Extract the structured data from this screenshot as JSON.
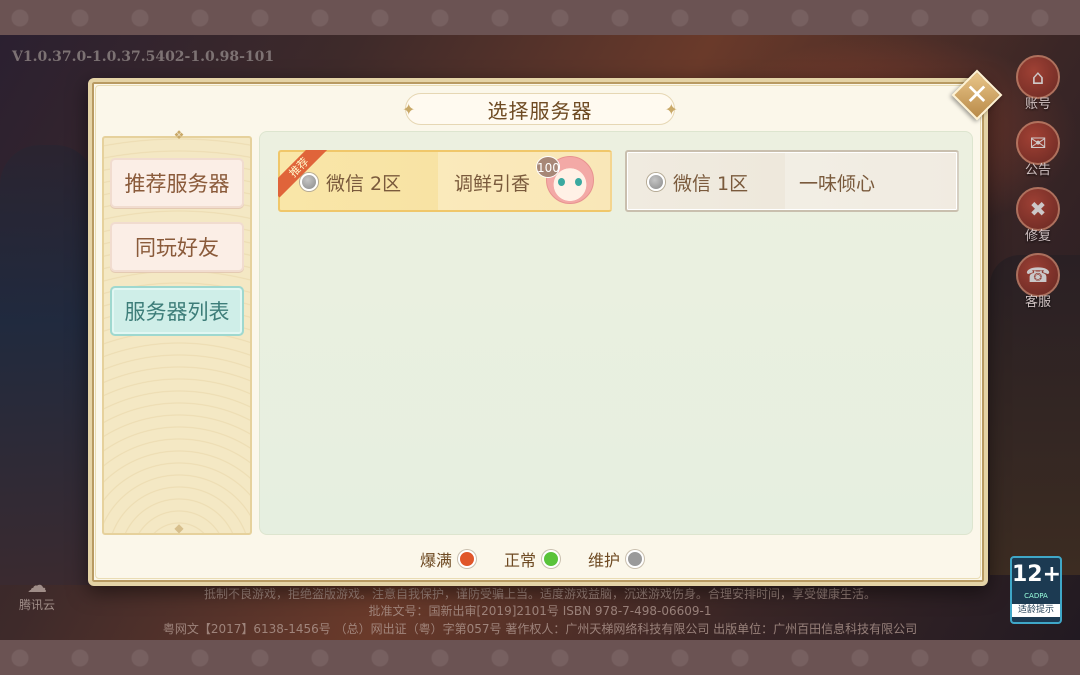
{
  "version": "V1.0.37.0-1.0.37.5402-1.0.98-101",
  "dialog": {
    "title": "选择服务器",
    "close_label": "✕"
  },
  "sidebar": {
    "tabs": [
      {
        "label": "推荐服务器",
        "active": false
      },
      {
        "label": "同玩好友",
        "active": false
      },
      {
        "label": "服务器列表",
        "active": true
      }
    ]
  },
  "servers": [
    {
      "name": "微信  2区",
      "role": "调鲜引香",
      "badge": "推荐",
      "level": "100",
      "status": "维护"
    },
    {
      "name": "微信  1区",
      "role": "一味倾心",
      "status": "维护"
    }
  ],
  "legend": [
    {
      "label": "爆满",
      "color": "#e0562a"
    },
    {
      "label": "正常",
      "color": "#59c33a"
    },
    {
      "label": "维护",
      "color": "#9a9a9a"
    }
  ],
  "right_menu": [
    {
      "label": "账号",
      "icon": "account-icon",
      "glyph": "⌂"
    },
    {
      "label": "公告",
      "icon": "announcement-icon",
      "glyph": "✉"
    },
    {
      "label": "修复",
      "icon": "repair-icon",
      "glyph": "✖"
    },
    {
      "label": "客服",
      "icon": "customer-service-icon",
      "glyph": "☎"
    }
  ],
  "age_rating": {
    "value": "12+",
    "org": "CADPA",
    "tip": "适龄提示"
  },
  "logo_left": {
    "glyph": "☁",
    "text": "腾讯云"
  },
  "footer": {
    "line1": "抵制不良游戏，拒绝盗版游戏。注意自我保护，谨防受骗上当。适度游戏益脑，沉迷游戏伤身。合理安排时间，享受健康生活。",
    "line2": "批准文号：国新出审[2019]2101号  ISBN  978-7-498-06609-1",
    "line3": "粤网文【2017】6138-1456号  （总）网出证（粤）字第057号  著作权人：广州天梯网络科技有限公司  出版单位：广州百田信息科技有限公司"
  }
}
